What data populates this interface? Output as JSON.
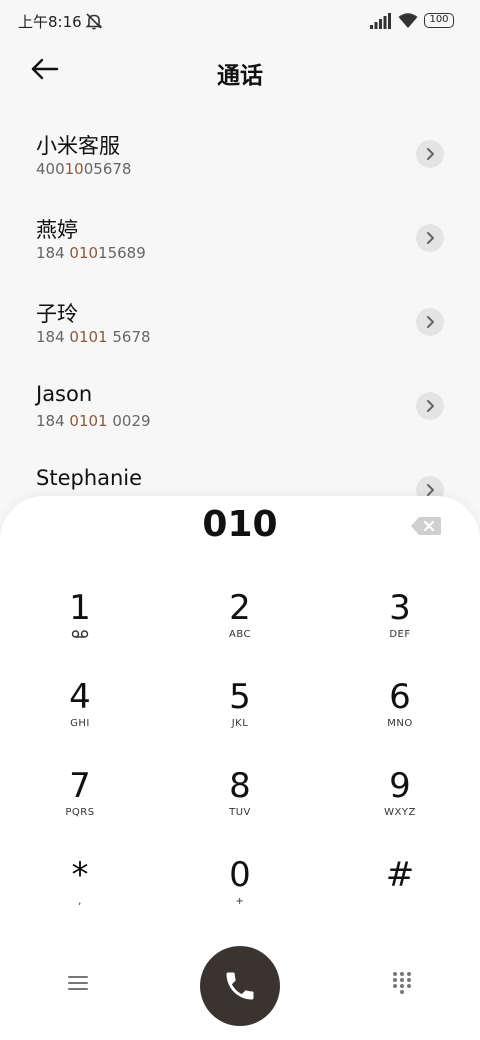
{
  "status_bar": {
    "time": "上午8:16",
    "battery": "100"
  },
  "header": {
    "title": "通话"
  },
  "contacts": [
    {
      "name": "小米客服",
      "number_pre": "400",
      "number_match": "10",
      "number_post": "05678"
    },
    {
      "name": "燕婷",
      "number_pre": "184 ",
      "number_match": "010",
      "number_post": "15689"
    },
    {
      "name": "子玲",
      "number_pre": "184 ",
      "number_match": "0101",
      "number_post": " 5678"
    },
    {
      "name": "Jason",
      "number_pre": "184 ",
      "number_match": "0101",
      "number_post": " 0029"
    },
    {
      "name": "Stephanie",
      "number_pre": "",
      "number_match": "",
      "number_post": ""
    }
  ],
  "dialpad": {
    "input": "010",
    "keys": [
      {
        "digit": "1",
        "letters": ""
      },
      {
        "digit": "2",
        "letters": "ABC"
      },
      {
        "digit": "3",
        "letters": "DEF"
      },
      {
        "digit": "4",
        "letters": "GHI"
      },
      {
        "digit": "5",
        "letters": "JKL"
      },
      {
        "digit": "6",
        "letters": "MNO"
      },
      {
        "digit": "7",
        "letters": "PQRS"
      },
      {
        "digit": "8",
        "letters": "TUV"
      },
      {
        "digit": "9",
        "letters": "WXYZ"
      },
      {
        "digit": "*",
        "letters": ","
      },
      {
        "digit": "0",
        "letters": "+"
      },
      {
        "digit": "#",
        "letters": ""
      }
    ]
  },
  "icons": {
    "back": "back-arrow-icon",
    "mute": "bell-off-icon",
    "signal": "signal-icon",
    "wifi": "wifi-icon",
    "chevron": "chevron-right-icon",
    "backspace": "backspace-icon",
    "menu": "menu-icon",
    "call": "phone-icon",
    "keypad": "keypad-icon",
    "voicemail": "voicemail-icon"
  },
  "colors": {
    "call_button": "#3a3430",
    "match_highlight": "#8a5a3c"
  }
}
